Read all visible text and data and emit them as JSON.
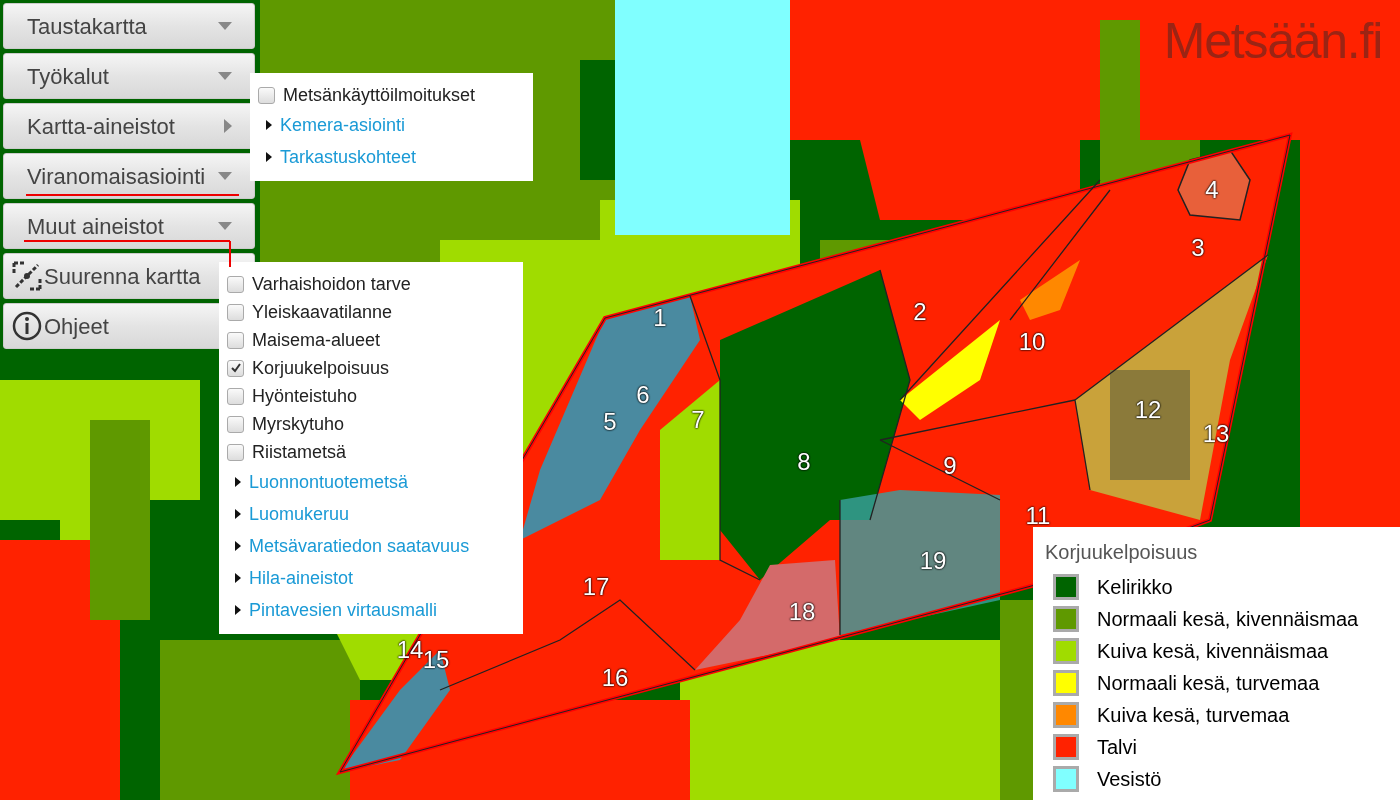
{
  "logo": "Metsään.fi",
  "menu": [
    {
      "label": "Taustakartta",
      "kind": "dropdown"
    },
    {
      "label": "Työkalut",
      "kind": "dropdown"
    },
    {
      "label": "Kartta-aineistot",
      "kind": "flyout"
    },
    {
      "label": "Viranomaisasiointi",
      "kind": "dropdown"
    },
    {
      "label": "Muut aineistot",
      "kind": "dropdown"
    },
    {
      "label": "Suurenna kartta",
      "kind": "zoom"
    },
    {
      "label": "Ohjeet",
      "kind": "help"
    }
  ],
  "submenus": [
    {
      "items": [
        {
          "kind": "checkbox",
          "label": "Metsänkäyttöilmoitukset",
          "checked": false
        },
        {
          "kind": "link",
          "label": "Kemera-asiointi"
        },
        {
          "kind": "link",
          "label": "Tarkastuskohteet"
        }
      ]
    },
    {
      "items": [
        {
          "kind": "checkbox",
          "label": "Varhaishoidon tarve",
          "checked": false
        },
        {
          "kind": "checkbox",
          "label": "Yleiskaavatilanne",
          "checked": false
        },
        {
          "kind": "checkbox",
          "label": "Maisema-alueet",
          "checked": false
        },
        {
          "kind": "checkbox",
          "label": "Korjuukelpoisuus",
          "checked": true
        },
        {
          "kind": "checkbox",
          "label": "Hyönteistuho",
          "checked": false
        },
        {
          "kind": "checkbox",
          "label": "Myrskytuho",
          "checked": false
        },
        {
          "kind": "checkbox",
          "label": "Riistametsä",
          "checked": false
        },
        {
          "kind": "link",
          "label": "Luonnontuotemetsä"
        },
        {
          "kind": "link",
          "label": "Luomukeruu"
        },
        {
          "kind": "link",
          "label": "Metsävaratiedon saatavuus"
        },
        {
          "kind": "link",
          "label": "Hila-aineistot"
        },
        {
          "kind": "link",
          "label": "Pintavesien virtausmalli"
        }
      ]
    }
  ],
  "parcels": [
    "1",
    "2",
    "3",
    "4",
    "5",
    "6",
    "7",
    "8",
    "9",
    "10",
    "11",
    "12",
    "13",
    "14",
    "15",
    "16",
    "17",
    "18",
    "19"
  ],
  "legend": {
    "title": "Korjuukelpoisuus",
    "items": [
      {
        "label": "Kelirikko",
        "color": "#006400"
      },
      {
        "label": "Normaali kesä, kivennäismaa",
        "color": "#5f9900"
      },
      {
        "label": "Kuiva kesä, kivennäismaa",
        "color": "#a0dc00"
      },
      {
        "label": "Normaali kesä, turvemaa",
        "color": "#ffff00"
      },
      {
        "label": "Kuiva kesä, turvemaa",
        "color": "#ff8800"
      },
      {
        "label": "Talvi",
        "color": "#ff2200"
      },
      {
        "label": "Vesistö",
        "color": "#80ffff"
      }
    ]
  }
}
